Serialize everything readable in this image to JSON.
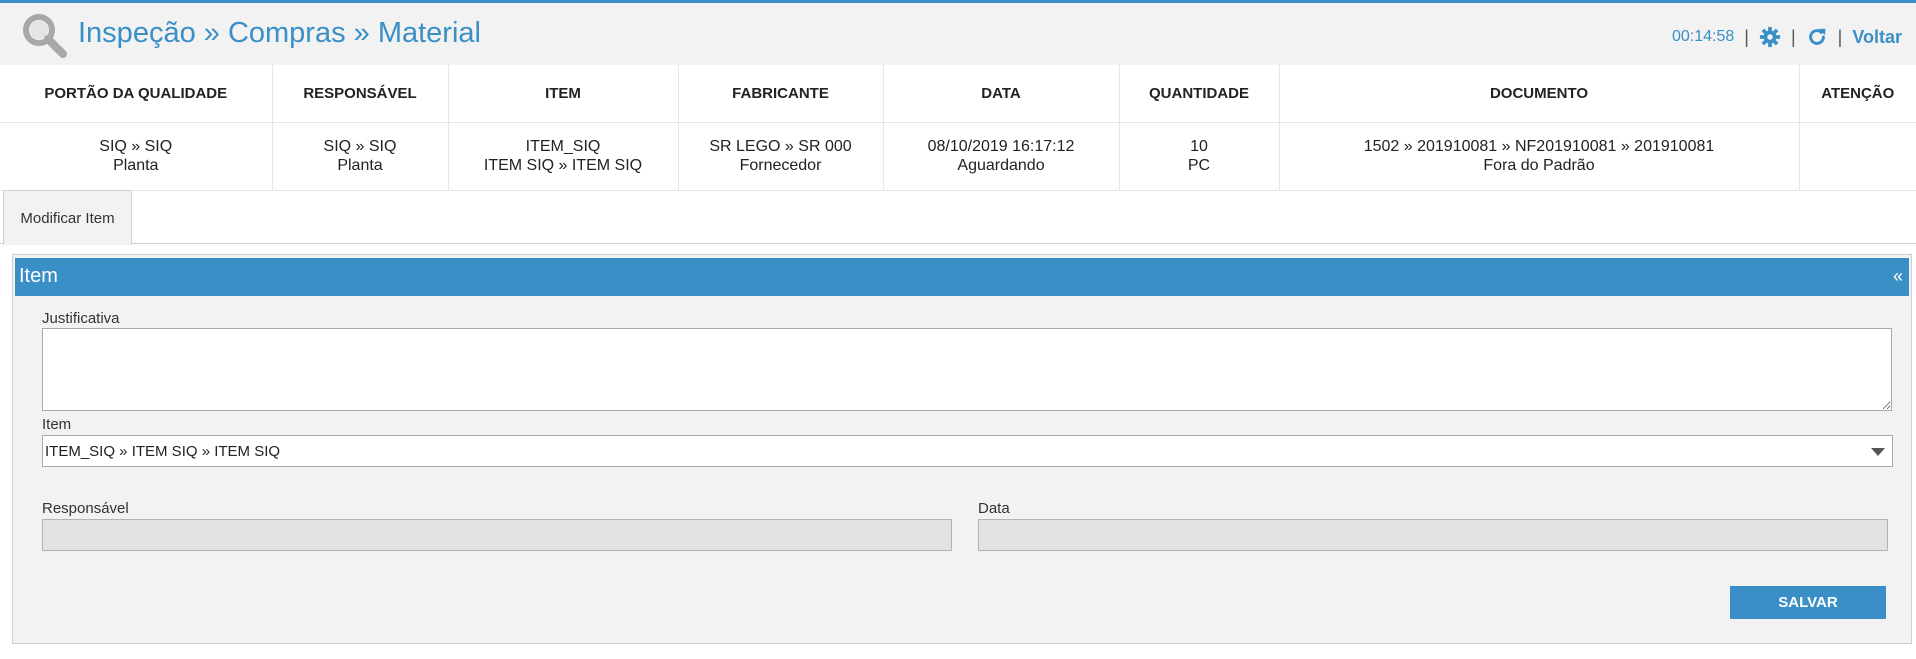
{
  "header": {
    "title": "Inspeção » Compras » Material",
    "timer": "00:14:58",
    "separator": "|",
    "back_label": "Voltar"
  },
  "table": {
    "columns": [
      "PORTÃO DA QUALIDADE",
      "RESPONSÁVEL",
      "ITEM",
      "FABRICANTE",
      "DATA",
      "QUANTIDADE",
      "DOCUMENTO",
      "ATENÇÃO"
    ],
    "row": [
      [
        "SIQ » SIQ",
        "Planta"
      ],
      [
        "SIQ » SIQ",
        "Planta"
      ],
      [
        "ITEM_SIQ",
        "ITEM SIQ » ITEM SIQ"
      ],
      [
        "SR LEGO » SR 000",
        "Fornecedor"
      ],
      [
        "08/10/2019 16:17:12",
        "Aguardando"
      ],
      [
        "10",
        "PC"
      ],
      [
        "1502 » 201910081 » NF201910081 » 201910081",
        "Fora do Padrão"
      ],
      [
        "",
        ""
      ]
    ]
  },
  "tabs": [
    {
      "label": "Modificar Item"
    }
  ],
  "panel": {
    "title": "Item",
    "collapse_glyph": "«",
    "justificativa": {
      "label": "Justificativa",
      "value": ""
    },
    "item": {
      "label": "Item",
      "value": "ITEM_SIQ » ITEM SIQ » ITEM SIQ"
    },
    "responsavel": {
      "label": "Responsável",
      "value": ""
    },
    "data": {
      "label": "Data",
      "value": ""
    },
    "save_label": "SALVAR"
  },
  "colors": {
    "accent": "#3a8fc7",
    "panel_bg": "#f2f2f2",
    "readonly_bg": "#e3e3e3"
  }
}
